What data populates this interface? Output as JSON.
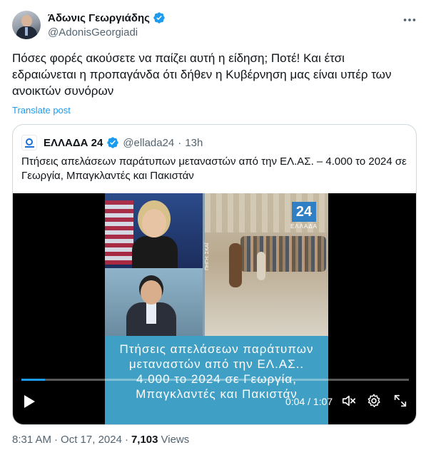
{
  "author": {
    "display_name": "Άδωνις Γεωργιάδης",
    "handle": "@AdonisGeorgiadi",
    "avatar_icon": "profile-photo"
  },
  "tweet": {
    "text": "Πόσες φορές ακούσετε να παίζει αυτή η είδηση; Ποτέ! Και έτσι εδραιώνεται η προπαγάνδα ότι δήθεν η Κυβέρνηση μας είναι υπέρ των ανοικτών συνόρων",
    "translate_label": "Translate post"
  },
  "quote": {
    "display_name": "ΕΛΛΑΔΑ 24",
    "handle": "@ellada24",
    "separator": "·",
    "time_ago": "13h",
    "text": "Πτήσεις απελάσεων παράτυπων μεταναστών από την ΕΛ.ΑΣ. – 4.000 το 2024 σε Γεωργία, Μπαγκλαντές και Πακιστάν"
  },
  "video": {
    "logo_text": "24",
    "logo_sub": "ΕΛΛΑΔΑ",
    "side_tag": "ΠΗΓΗ: ΣΚΑΪ",
    "caption": "Πτήσεις απελάσεων παράτυπων μεταναστών από την ΕΛ.ΑΣ.. 4.000 το 2024 σε Γεωργία, Μπαγκλαντές και Πακιστάν",
    "current_time": "0:04",
    "duration": "1:07",
    "time_display": "0:04 / 1:07",
    "progress_fraction": 0.06
  },
  "footer": {
    "time": "8:31 AM",
    "separator": "·",
    "date": "Oct 17, 2024",
    "views_count": "7,103",
    "views_label": "Views"
  },
  "colors": {
    "accent": "#1d9bf0",
    "text_primary": "#0f1419",
    "text_secondary": "#536471",
    "border": "#cfd9de"
  }
}
